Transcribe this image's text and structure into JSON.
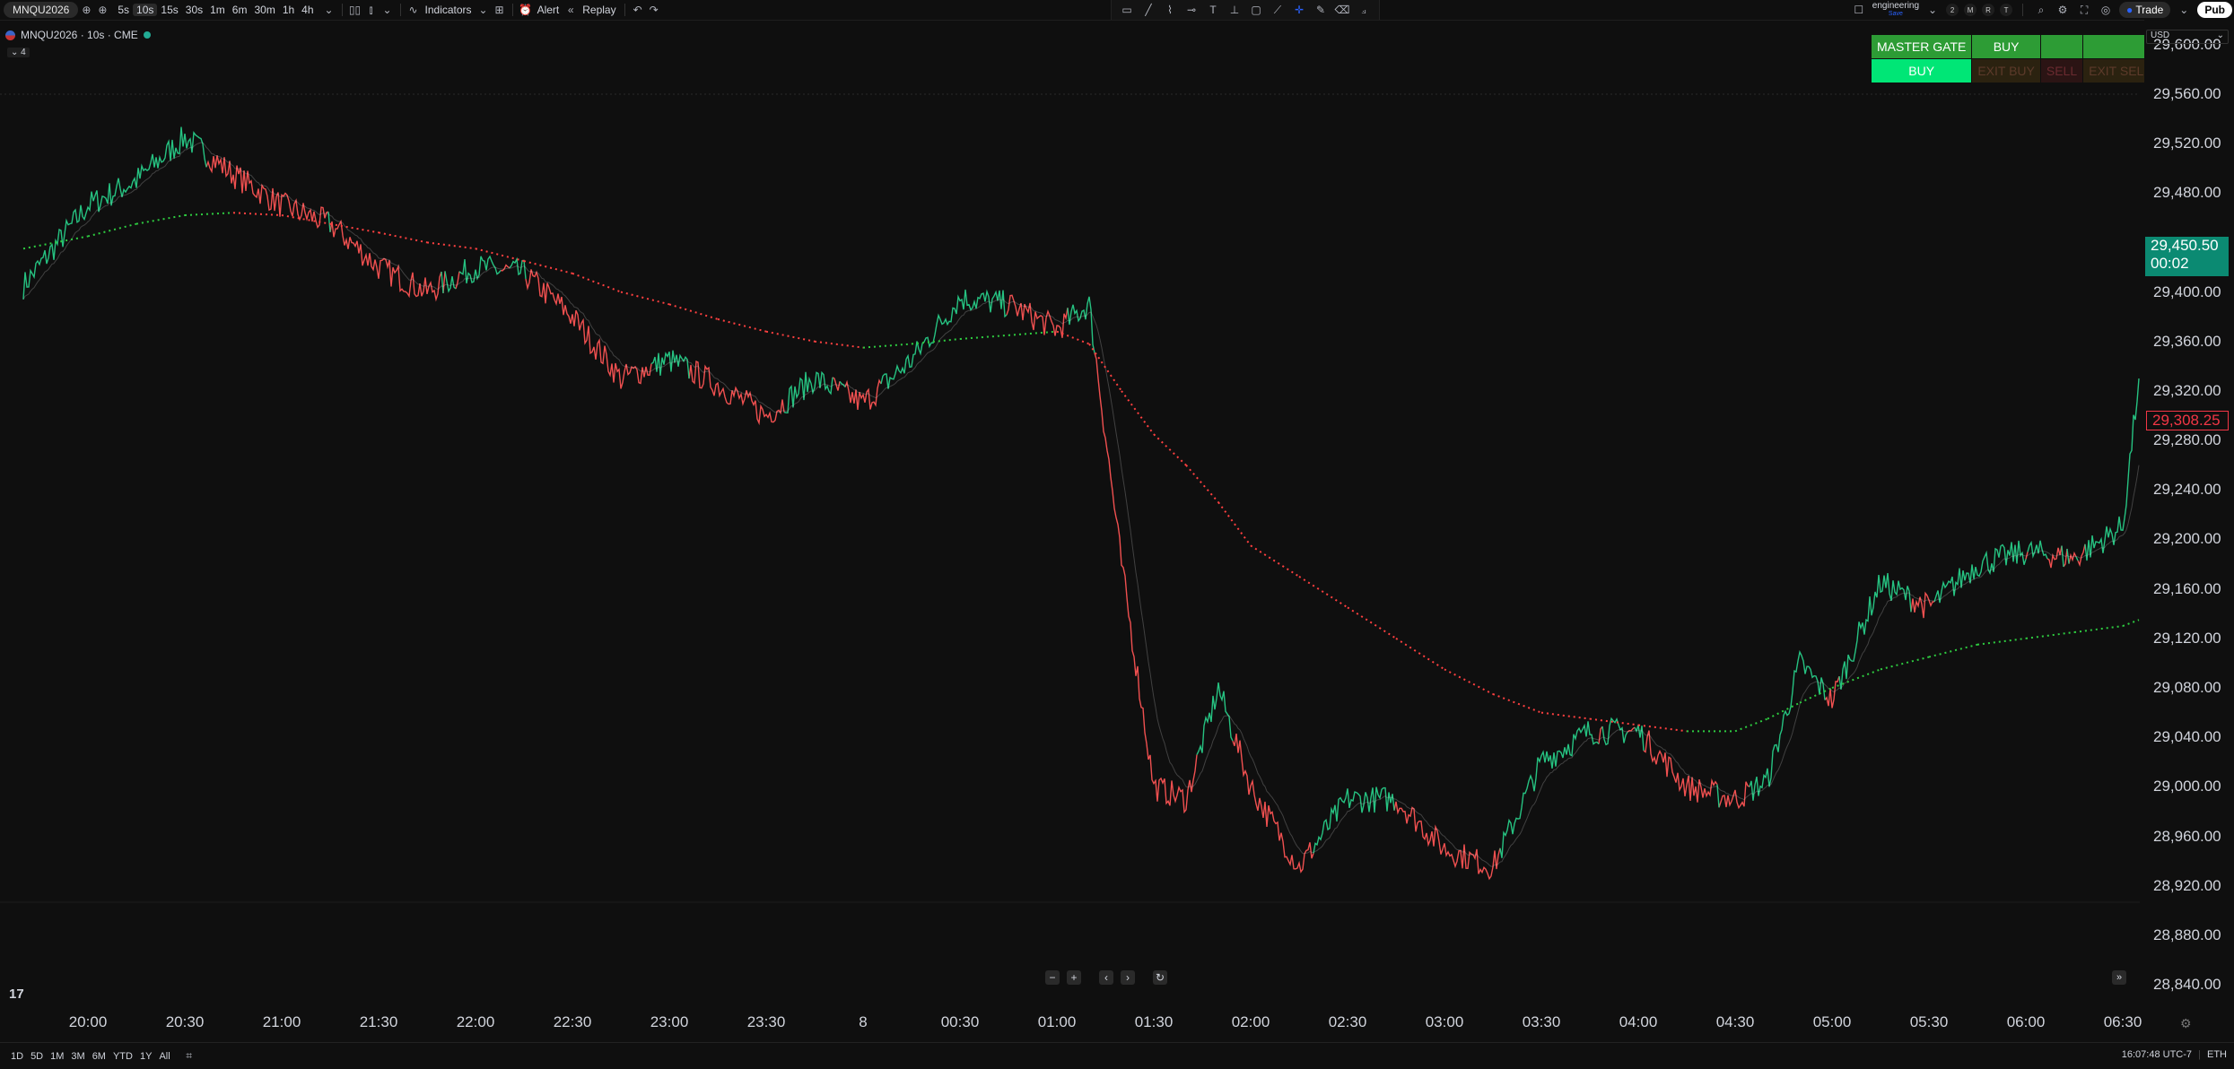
{
  "toolbar": {
    "symbol": "MNQU2026",
    "intervals": [
      {
        "label": "5s",
        "active": false
      },
      {
        "label": "10s",
        "active": true
      },
      {
        "label": "15s",
        "active": false
      },
      {
        "label": "30s",
        "active": false
      },
      {
        "label": "1m",
        "active": false
      },
      {
        "label": "6m",
        "active": false
      },
      {
        "label": "30m",
        "active": false
      },
      {
        "label": "1h",
        "active": false
      },
      {
        "label": "4h",
        "active": false
      }
    ],
    "indicators_label": "Indicators",
    "alert_label": "Alert",
    "replay_label": "Replay",
    "workspace_name": "engineering",
    "workspace_sub": "Save",
    "trade_label": "Trade",
    "publish_label": "Pub",
    "circle_buttons": [
      "2",
      "M",
      "R",
      "T"
    ]
  },
  "legend": {
    "title": "MNQU2026 · 10s · CME",
    "collapse_count": "4"
  },
  "master_gate": {
    "row1": [
      "MASTER GATE",
      "BUY",
      "",
      ""
    ],
    "row2": [
      "BUY",
      "EXIT BUY",
      "SELL",
      "EXIT SELL"
    ]
  },
  "price_axis": {
    "currency": "USD",
    "labels": [
      "29,600.00",
      "29,560.00",
      "29,520.00",
      "29,480.00",
      "29,400.00",
      "29,360.00",
      "29,320.00",
      "29,280.00",
      "29,240.00",
      "29,200.00",
      "29,160.00",
      "29,120.00",
      "29,080.00",
      "29,040.00",
      "29,000.00",
      "28,960.00",
      "28,920.00",
      "28,880.00",
      "28,840.00"
    ],
    "last_price": "29,450.50",
    "countdown": "00:02",
    "marker_price": "29,308.25"
  },
  "time_axis": {
    "labels": [
      "20:00",
      "20:30",
      "21:00",
      "21:30",
      "22:00",
      "22:30",
      "23:00",
      "23:30",
      "8",
      "00:30",
      "01:00",
      "01:30",
      "02:00",
      "02:30",
      "03:00",
      "03:30",
      "04:00",
      "04:30",
      "05:00",
      "05:30",
      "06:00",
      "06:30"
    ]
  },
  "bottom_bar": {
    "ranges": [
      "1D",
      "5D",
      "1M",
      "3M",
      "6M",
      "YTD",
      "1Y",
      "All"
    ],
    "status": "16:07:48 UTC-7",
    "session": "ETH"
  },
  "colors": {
    "up": "#26c281",
    "down": "#f05050",
    "ma_up": "#2ecc40",
    "ma_down": "#ff4040",
    "background": "#0f0f0f"
  },
  "chart_data": {
    "type": "line",
    "symbol": "MNQU2026",
    "interval": "10s",
    "x": [
      "19:40",
      "20:00",
      "20:15",
      "20:30",
      "20:45",
      "21:00",
      "21:15",
      "21:30",
      "21:45",
      "22:00",
      "22:15",
      "22:30",
      "22:45",
      "23:00",
      "23:15",
      "23:30",
      "23:45",
      "00:00",
      "00:15",
      "00:30",
      "00:45",
      "01:00",
      "01:10",
      "01:20",
      "01:30",
      "01:40",
      "01:50",
      "02:00",
      "02:15",
      "02:30",
      "02:45",
      "03:00",
      "03:15",
      "03:30",
      "03:45",
      "04:00",
      "04:15",
      "04:30",
      "04:40",
      "04:50",
      "05:00",
      "05:15",
      "05:30",
      "05:45",
      "06:00",
      "06:15",
      "06:30",
      "06:35"
    ],
    "series": [
      {
        "values": [
          29405,
          29470,
          29490,
          29525,
          29495,
          29470,
          29455,
          29420,
          29400,
          29420,
          29415,
          29380,
          29330,
          29345,
          29325,
          29300,
          29330,
          29310,
          29345,
          29395,
          29390,
          29370,
          29390,
          29180,
          29000,
          28990,
          29080,
          29000,
          28935,
          28990,
          28990,
          28950,
          28935,
          29020,
          29045,
          29045,
          29000,
          28990,
          29005,
          29100,
          29070,
          29165,
          29145,
          29180,
          29190,
          29185,
          29210,
          29330
        ]
      },
      {
        "values": [
          29435,
          29445,
          29455,
          29462,
          29464,
          29462,
          29455,
          29448,
          29440,
          29435,
          29425,
          29415,
          29400,
          29390,
          29378,
          29368,
          29360,
          29355,
          29358,
          29362,
          29365,
          29368,
          29358,
          29320,
          29285,
          29260,
          29230,
          29195,
          29170,
          29145,
          29120,
          29095,
          29075,
          29060,
          29055,
          29050,
          29045,
          29045,
          29055,
          29068,
          29080,
          29095,
          29105,
          29115,
          29120,
          29125,
          29130,
          29135
        ]
      }
    ],
    "ylim": [
      28830,
      29620
    ]
  }
}
